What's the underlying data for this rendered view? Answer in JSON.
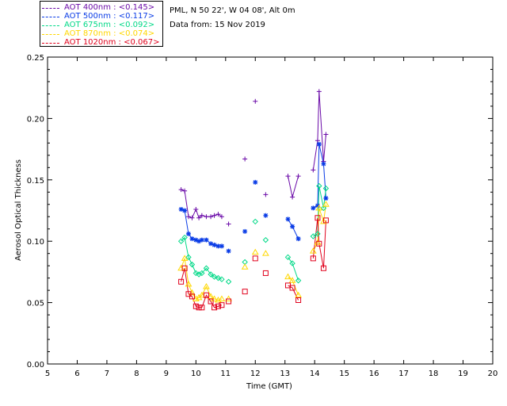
{
  "header": {
    "site": "PML, N 50 22', W 04 08', Alt 0m",
    "date": "Data from: 15 Nov 2019"
  },
  "chart_data": {
    "type": "scatter",
    "xlabel": "Time (GMT)",
    "ylabel": "Aerosol Optical Thickness",
    "xlim": [
      5,
      20
    ],
    "ylim": [
      0.0,
      0.25
    ],
    "xticks": [
      "5",
      "6",
      "7",
      "8",
      "9",
      "10",
      "11",
      "12",
      "13",
      "14",
      "15",
      "16",
      "17",
      "18",
      "19",
      "20"
    ],
    "yticks": [
      "0.00",
      "0.05",
      "0.10",
      "0.15",
      "0.20",
      "0.25"
    ],
    "grid": false,
    "legend_position": "top-left",
    "series": [
      {
        "name": "AOT  400nm : <0.145>",
        "color": "#6a0aa8",
        "marker": "plus",
        "x": [
          9.5,
          9.62,
          9.75,
          9.87,
          10.0,
          10.1,
          10.2,
          10.35,
          10.5,
          10.62,
          10.75,
          10.87,
          11.1,
          11.65,
          12.0,
          12.35,
          13.1,
          13.25,
          13.45,
          13.95,
          14.1,
          14.15,
          14.3,
          14.38
        ],
        "y": [
          0.142,
          0.141,
          0.12,
          0.119,
          0.126,
          0.119,
          0.121,
          0.12,
          0.12,
          0.121,
          0.122,
          0.12,
          0.114,
          0.167,
          0.214,
          0.138,
          0.153,
          0.136,
          0.153,
          0.158,
          0.182,
          0.222,
          0.165,
          0.187
        ]
      },
      {
        "name": "AOT  500nm : <0.117>",
        "color": "#0a3ce6",
        "marker": "star",
        "x": [
          9.5,
          9.62,
          9.75,
          9.87,
          10.0,
          10.1,
          10.2,
          10.35,
          10.5,
          10.62,
          10.75,
          10.87,
          11.1,
          11.65,
          12.0,
          12.35,
          13.1,
          13.25,
          13.45,
          13.95,
          14.1,
          14.15,
          14.3,
          14.38
        ],
        "y": [
          0.126,
          0.125,
          0.106,
          0.102,
          0.101,
          0.1,
          0.101,
          0.101,
          0.098,
          0.097,
          0.096,
          0.096,
          0.092,
          0.108,
          0.148,
          0.121,
          0.118,
          0.112,
          0.102,
          0.127,
          0.129,
          0.179,
          0.163,
          0.135
        ]
      },
      {
        "name": "AOT  675nm : <0.092>",
        "color": "#00d987",
        "marker": "diamond",
        "x": [
          9.5,
          9.62,
          9.75,
          9.87,
          10.0,
          10.1,
          10.2,
          10.35,
          10.5,
          10.62,
          10.75,
          10.87,
          11.1,
          11.65,
          12.0,
          12.35,
          13.1,
          13.25,
          13.45,
          13.95,
          14.1,
          14.15,
          14.3,
          14.38
        ],
        "y": [
          0.1,
          0.103,
          0.087,
          0.081,
          0.074,
          0.073,
          0.074,
          0.078,
          0.073,
          0.071,
          0.07,
          0.069,
          0.067,
          0.083,
          0.116,
          0.101,
          0.087,
          0.082,
          0.068,
          0.104,
          0.106,
          0.145,
          0.127,
          0.143
        ]
      },
      {
        "name": "AOT  870nm : <0.074>",
        "color": "#ffd700",
        "marker": "triangle",
        "x": [
          9.5,
          9.62,
          9.75,
          9.87,
          10.0,
          10.1,
          10.2,
          10.35,
          10.5,
          10.62,
          10.75,
          10.87,
          11.1,
          11.65,
          12.0,
          12.35,
          13.1,
          13.25,
          13.45,
          13.95,
          14.1,
          14.15,
          14.3,
          14.38
        ],
        "y": [
          0.078,
          0.086,
          0.065,
          0.058,
          0.053,
          0.054,
          0.056,
          0.063,
          0.055,
          0.053,
          0.052,
          0.053,
          0.053,
          0.079,
          0.091,
          0.09,
          0.071,
          0.068,
          0.056,
          0.092,
          0.099,
          0.127,
          0.116,
          0.13
        ]
      },
      {
        "name": "AOT 1020nm : <0.067>",
        "color": "#e0001b",
        "marker": "square",
        "x": [
          9.5,
          9.62,
          9.75,
          9.87,
          10.0,
          10.1,
          10.2,
          10.35,
          10.5,
          10.62,
          10.75,
          10.87,
          11.1,
          11.65,
          12.0,
          12.35,
          13.1,
          13.25,
          13.45,
          13.95,
          14.1,
          14.15,
          14.3,
          14.38
        ],
        "y": [
          0.067,
          0.078,
          0.057,
          0.055,
          0.047,
          0.046,
          0.046,
          0.056,
          0.051,
          0.046,
          0.047,
          0.048,
          0.051,
          0.059,
          0.086,
          0.074,
          0.064,
          0.062,
          0.052,
          0.086,
          0.119,
          0.098,
          0.078,
          0.117
        ]
      }
    ]
  }
}
